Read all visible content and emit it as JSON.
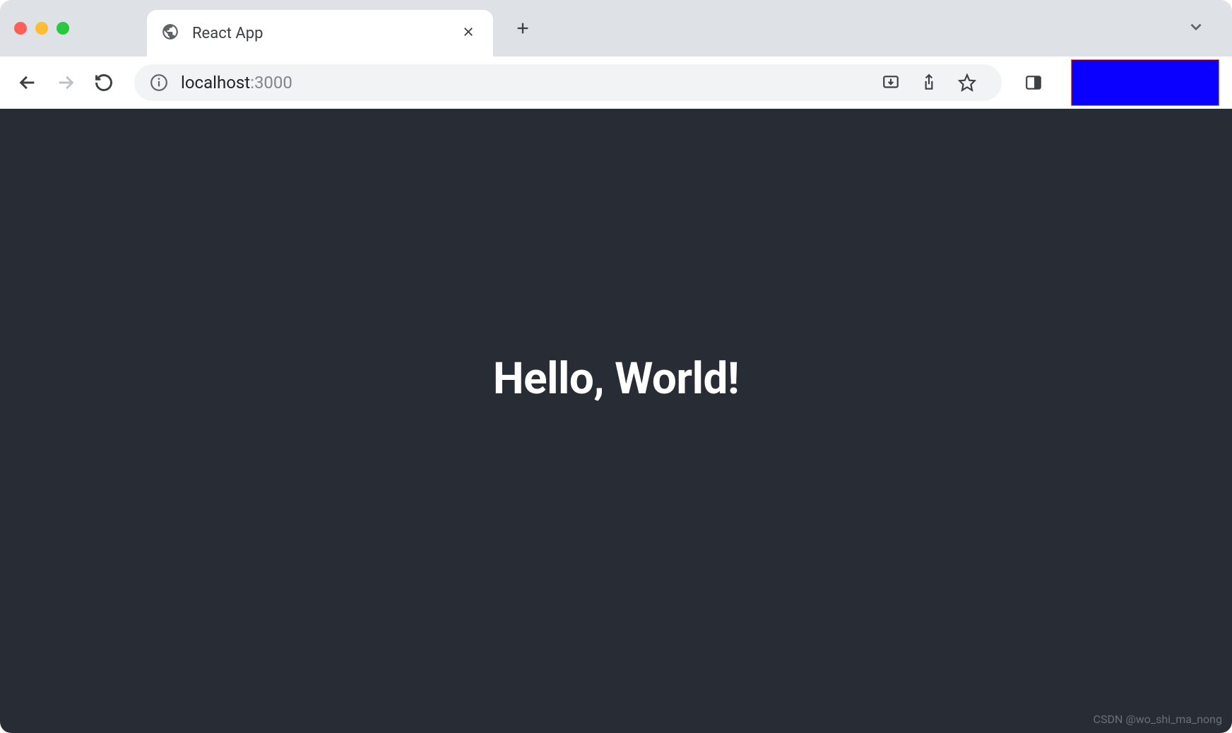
{
  "tab": {
    "title": "React App"
  },
  "address": {
    "host": "localhost",
    "port": ":3000"
  },
  "page": {
    "heading": "Hello, World!"
  },
  "watermark": "CSDN @wo_shi_ma_nong"
}
